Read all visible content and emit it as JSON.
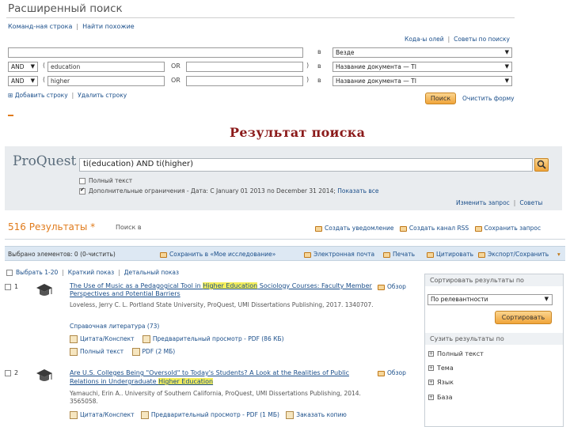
{
  "advanced": {
    "title": "Расширенный поиск",
    "links": [
      "Команд-ная строка",
      "Найти похожие"
    ],
    "right_links": [
      "Кода-ы олей",
      "Советы по поиску"
    ],
    "rows": [
      {
        "operator": "",
        "value": "",
        "field": "Везде"
      },
      {
        "operator": "AND",
        "value": "education",
        "field": "Название документа — TI"
      },
      {
        "operator": "AND",
        "value": "higher",
        "field": "Название документа — TI"
      }
    ],
    "or_label": "OR",
    "add_row": "Добавить строку",
    "remove_row": "Удалить строку",
    "search_button": "Поиск",
    "clear_form": "Очистить форму"
  },
  "result_heading": "Результат поиска",
  "proquest": {
    "logo": "ProQuest",
    "query": "ti(education) AND ti(higher)",
    "full_text": "Полный текст",
    "extra_limits": "Дополнительные ограничения - Дата: С January 01 2013 по December 31 2014;",
    "show_all": "Показать все",
    "modify_query": "Изменить запрос",
    "tips": "Советы"
  },
  "results_count": "516 Результаты *",
  "search_within": "Поиск в",
  "actions": [
    "Создать уведомление",
    "Создать канал RSS",
    "Сохранить запрос"
  ],
  "toolbar": {
    "selected": "Выбрано элементов: 0 (0-чистить)",
    "items": [
      "Сохранить в «Мое исследование»",
      "Электронная почта",
      "Печать",
      "Цитировать",
      "Экспорт/Сохранить"
    ]
  },
  "list_header": {
    "select": "Выбрать 1-20",
    "brief": "Краткий показ",
    "detailed": "Детальный показ"
  },
  "results": [
    {
      "num": "1",
      "title_pre": "The Use of Music as a Pedagogical Tool in ",
      "title_hl": "Higher Education",
      "title_post": " Sociology Courses: Faculty Member Perspectives and Potential Barriers",
      "meta1": "Loveless, Jerry C. L. Portland State University, ProQuest, UMI Dissertations Publishing, 2017. 1340707.",
      "meta2": "Справочная литература (73)",
      "links": [
        "Цитата/Конспект",
        "Предварительный просмотр - PDF (86 КБ)",
        "Полный текст",
        "PDF (2 МБ)"
      ],
      "overview": "Обзор"
    },
    {
      "num": "2",
      "title_pre": "Are U.S. Colleges Being \"Oversold\" to Today's Students? A Look at the Realities of Public Relations in Undergraduate ",
      "title_hl": "Higher Education",
      "title_post": "",
      "meta1": "Yamauchi, Erin A.. University of Southern California, ProQuest, UMI Dissertations Publishing, 2014. 3565058.",
      "links": [
        "Цитата/Конспект",
        "Предварительный просмотр - PDF (1 МБ)",
        "Заказать копию"
      ],
      "overview": "Обзор"
    }
  ],
  "sidebar": {
    "sort_label": "Сортировать результаты по",
    "sort_value": "По релевантности",
    "sort_button": "Сортировать",
    "narrow_label": "Сузить результаты по",
    "facets": [
      "Полный текст",
      "Тема",
      "Язык",
      "База"
    ]
  },
  "colors": {
    "accent_orange": "#e07b1c",
    "highlight": "#f5ef5c",
    "heading_red": "#8b1a1a",
    "toolbar_blue": "#dde8f3"
  }
}
